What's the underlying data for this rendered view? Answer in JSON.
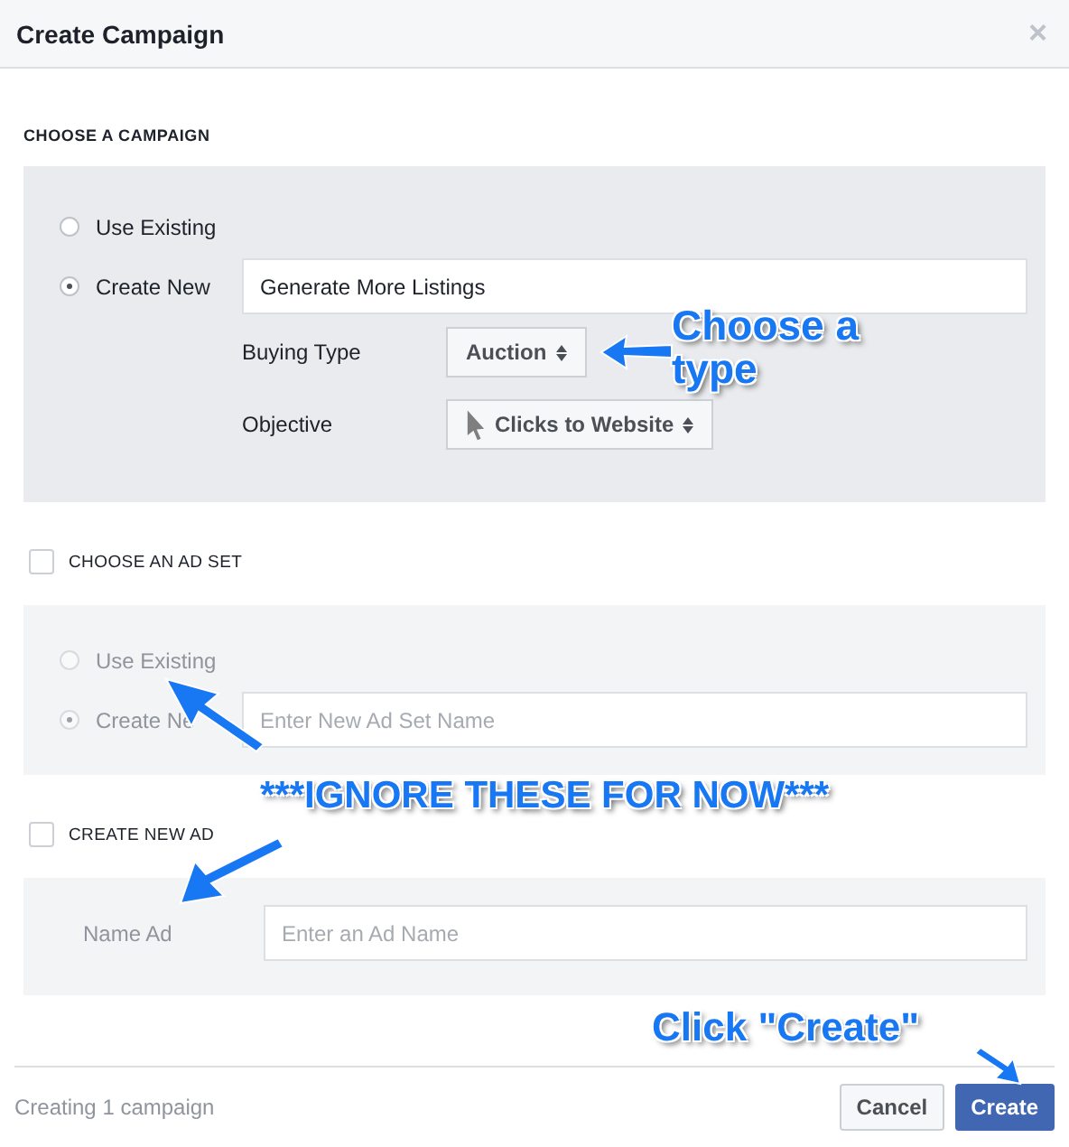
{
  "window": {
    "title": "Create Campaign",
    "close": "×"
  },
  "campaign_section": {
    "title": "CHOOSE A CAMPAIGN",
    "options": [
      {
        "label": "Use Existing",
        "selected": false
      },
      {
        "label": "Create New",
        "selected": true
      }
    ],
    "name_field": {
      "value": "Generate More Listings"
    },
    "buying_type": {
      "label": "Buying Type",
      "value": "Auction"
    },
    "objective": {
      "label": "Objective",
      "value": "Clicks to Website"
    }
  },
  "ad_set_section": {
    "title": "CHOOSE AN AD SET",
    "checked": false,
    "disabled": true,
    "options": [
      {
        "label": "Use Existing",
        "selected": false
      },
      {
        "label": "Create Ne",
        "selected": true
      }
    ],
    "name_field": {
      "placeholder": "Enter New Ad Set Name"
    }
  },
  "ad_section": {
    "title": "CREATE NEW AD",
    "checked": false,
    "name_label": "Name Ad",
    "name_field": {
      "placeholder": "Enter an Ad Name"
    }
  },
  "footer": {
    "status": "Creating 1 campaign",
    "buttons": [
      {
        "label": "Cancel",
        "kind": "secondary"
      },
      {
        "label": "Create",
        "kind": "primary"
      }
    ]
  },
  "annotations": [
    {
      "text": "Choose a type"
    },
    {
      "text": "***IGNORE THESE FOR NOW***"
    },
    {
      "text": "Click \"Create\""
    }
  ]
}
